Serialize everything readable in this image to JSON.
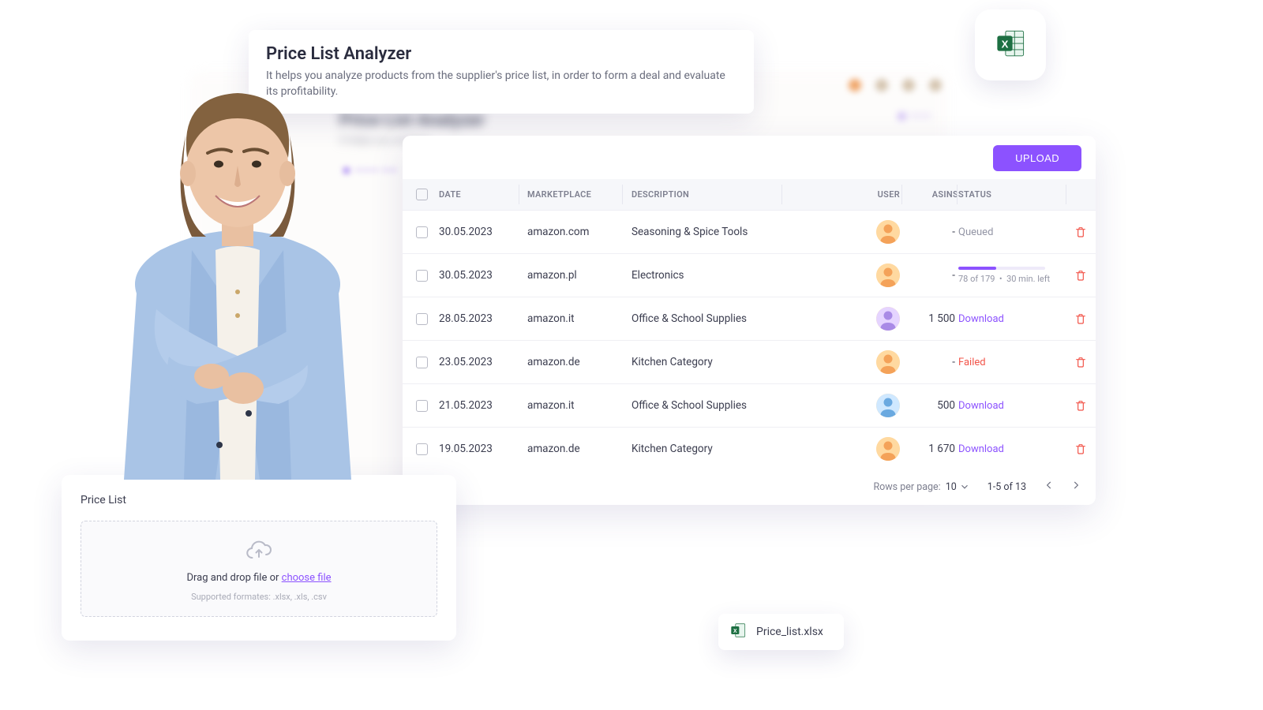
{
  "intro": {
    "title": "Price List Analyzer",
    "subtitle": "It helps you analyze products from the supplier's price list, in order to form a deal and evaluate its profitability."
  },
  "upload_button": "UPLOAD",
  "columns": {
    "date": "DATE",
    "marketplace": "MARKETPLACE",
    "description": "DESCRIPTION",
    "user": "USER",
    "asins": "ASINS",
    "status": "STATUS"
  },
  "rows": [
    {
      "date": "30.05.2023",
      "marketplace": "amazon.com",
      "description": "Seasoning & Spice Tools",
      "asins": "-",
      "status_type": "queued",
      "status_label": "Queued",
      "avatar": "orange"
    },
    {
      "date": "30.05.2023",
      "marketplace": "amazon.pl",
      "description": "Electronics",
      "asins": "-",
      "status_type": "progress",
      "progress_done": 78,
      "progress_total": 179,
      "progress_eta": "30 min. left",
      "progress_pct": 44,
      "avatar": "orange"
    },
    {
      "date": "28.05.2023",
      "marketplace": "amazon.it",
      "description": "Office & School Supplies",
      "asins": "1 500",
      "status_type": "download",
      "status_label": "Download",
      "avatar": "purple"
    },
    {
      "date": "23.05.2023",
      "marketplace": "amazon.de",
      "description": "Kitchen Category",
      "asins": "-",
      "status_type": "failed",
      "status_label": "Failed",
      "avatar": "orange"
    },
    {
      "date": "21.05.2023",
      "marketplace": "amazon.it",
      "description": "Office & School Supplies",
      "asins": "500",
      "status_type": "download",
      "status_label": "Download",
      "avatar": "blue"
    },
    {
      "date": "19.05.2023",
      "marketplace": "amazon.de",
      "description": "Kitchen Category",
      "asins": "1 670",
      "status_type": "download",
      "status_label": "Download",
      "avatar": "orange"
    }
  ],
  "pagination": {
    "rows_per_page_label": "Rows per page:",
    "rows_per_page_value": "10",
    "range": "1-5 of 13"
  },
  "price_list_card": {
    "title": "Price List",
    "drop_text_prefix": "Drag and drop file or ",
    "drop_link": "choose file",
    "supported": "Supported formates: .xlsx, .xls, .csv"
  },
  "file_chip": {
    "name": "Price_list.xlsx"
  },
  "colors": {
    "accent": "#8c52ff",
    "danger": "#f2554a",
    "muted": "#9395a5"
  }
}
